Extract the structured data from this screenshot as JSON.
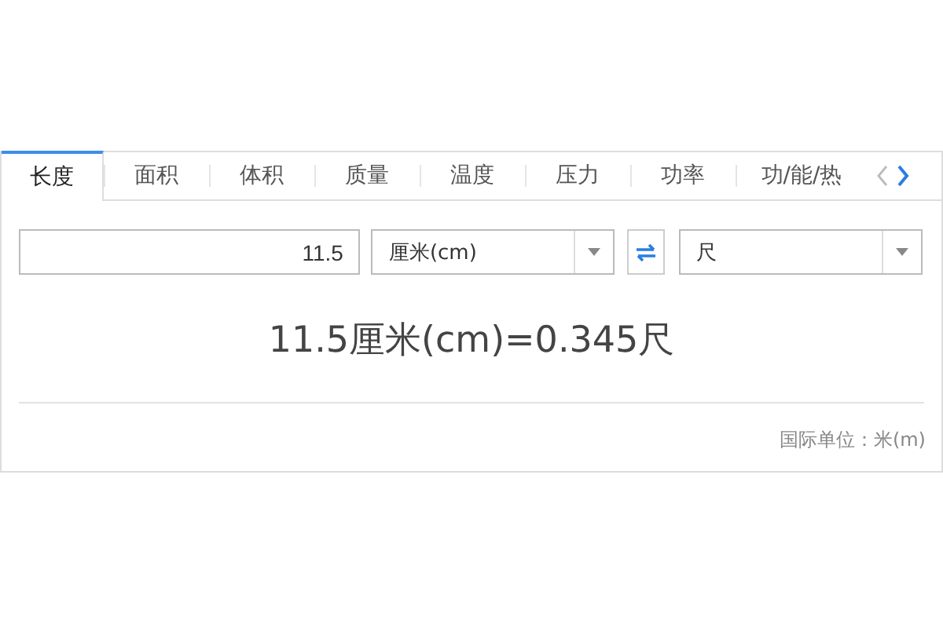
{
  "tabs": [
    {
      "label": "长度",
      "selected": true
    },
    {
      "label": "面积",
      "selected": false
    },
    {
      "label": "体积",
      "selected": false
    },
    {
      "label": "质量",
      "selected": false
    },
    {
      "label": "温度",
      "selected": false
    },
    {
      "label": "压力",
      "selected": false
    },
    {
      "label": "功率",
      "selected": false
    },
    {
      "label": "功/能/热",
      "selected": false
    }
  ],
  "tab_scroll": [
    {
      "kind": "previous",
      "disabled": true
    },
    {
      "kind": "next",
      "disabled": false
    }
  ],
  "converter": {
    "value": "11.5",
    "from_unit": "厘米(cm)",
    "to_unit": "尺"
  },
  "result": "11.5厘米(cm)=0.345尺",
  "footer": "国际单位：米(m)"
}
